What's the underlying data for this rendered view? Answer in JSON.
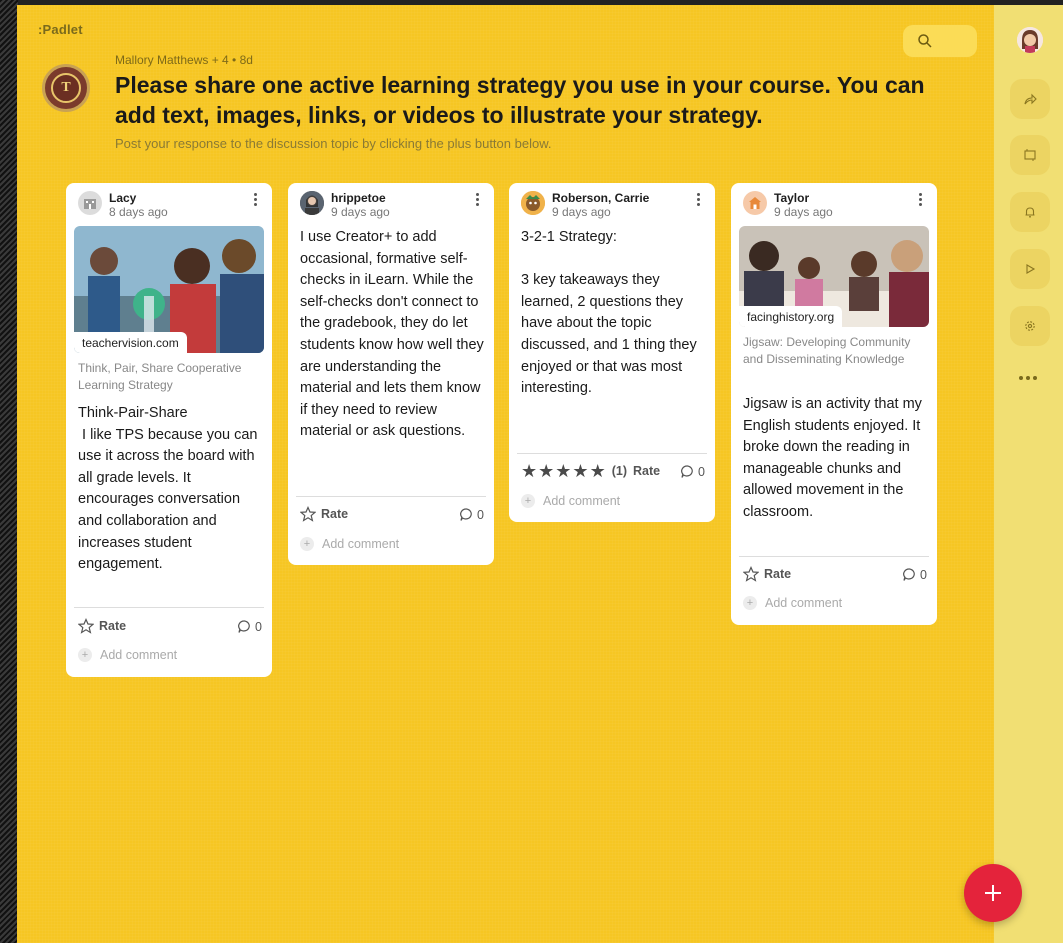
{
  "app": {
    "logo": ":Padlet"
  },
  "header": {
    "meta": "Mallory Matthews + 4 • 8d",
    "title": "Please share one active learning strategy you use in your course. You can add text, images, links, or videos to illustrate your strategy.",
    "subtitle": "Post your response to the discussion topic by clicking the plus button below."
  },
  "posts": [
    {
      "author": "Lacy",
      "time": "8 days ago",
      "image_domain": "teachervision.com",
      "link_title": "Think, Pair, Share Cooperative Learning Strategy",
      "body": "Think-Pair-Share\n I like TPS because you can use it across the board with all grade levels. It encourages conversation and collaboration and increases student engagement.",
      "rate_label": "Rate",
      "comment_count": "0",
      "add_comment": "Add comment"
    },
    {
      "author": "hrippetoe",
      "time": "9 days ago",
      "body": "I use Creator+ to add occasional, formative self-checks in iLearn. While the self-checks don't connect to the gradebook, they do let students know how well they are understanding the material and lets them know if they need to review material or ask questions.",
      "rate_label": "Rate",
      "comment_count": "0",
      "add_comment": "Add comment"
    },
    {
      "author": "Roberson, Carrie",
      "time": "9 days ago",
      "body": "3-2-1 Strategy:\n\n3 key takeaways they learned, 2 questions they have about the topic discussed, and 1 thing they enjoyed or that was most interesting.",
      "rating_count": "(1)",
      "rating_stars": 5,
      "rate_label": "Rate",
      "comment_count": "0",
      "add_comment": "Add comment"
    },
    {
      "author": "Taylor",
      "time": "9 days ago",
      "image_domain": "facinghistory.org",
      "link_title": "Jigsaw: Developing Community and Disseminating Knowledge",
      "body": "Jigsaw is an activity that my English students enjoyed. It broke down the reading in manageable chunks and allowed movement in the classroom.",
      "rate_label": "Rate",
      "comment_count": "0",
      "add_comment": "Add comment"
    }
  ],
  "colors": {
    "board": "#f6c623",
    "rail": "#f1df73",
    "fab": "#e4233b"
  },
  "rail": {
    "icons": [
      "share-icon",
      "remake-icon",
      "bell-icon",
      "play-icon",
      "settings-icon",
      "more-icon"
    ]
  }
}
